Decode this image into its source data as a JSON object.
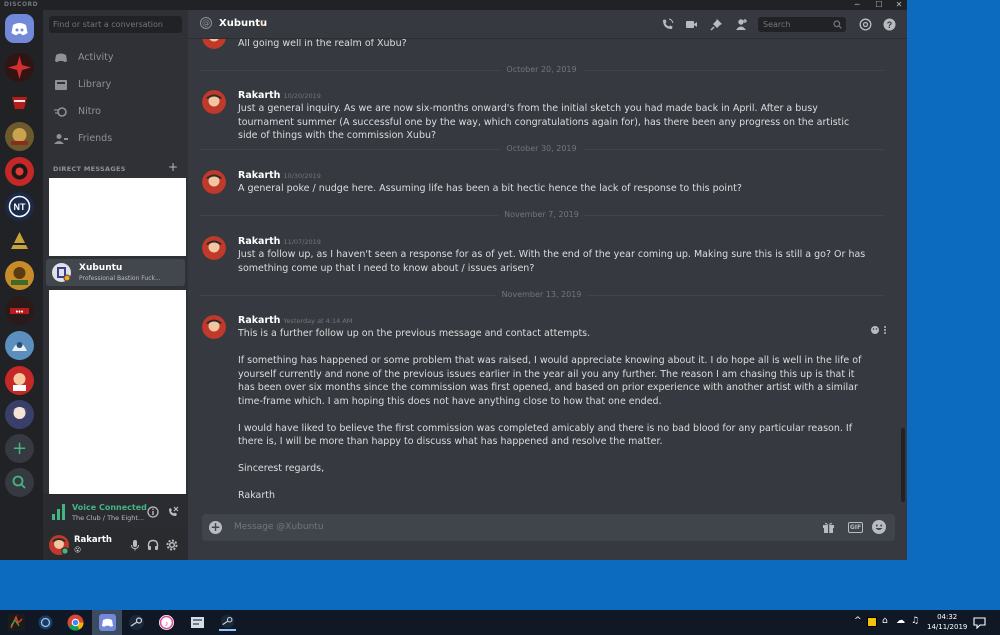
{
  "app": {
    "logo": "DISCORD"
  },
  "window_controls": [
    "minimize-icon",
    "maximize-icon",
    "close-icon"
  ],
  "sidebar": {
    "search_placeholder": "Find or start a conversation",
    "nav": [
      {
        "label": "Activity",
        "icon": "activity-icon"
      },
      {
        "label": "Library",
        "icon": "library-icon"
      },
      {
        "label": "Nitro",
        "icon": "nitro-icon"
      },
      {
        "label": "Friends",
        "icon": "friends-icon"
      }
    ],
    "dm_header": "DIRECT MESSAGES",
    "active_dm": {
      "name": "Xubuntu",
      "status": "Professional Bastion Fuck..."
    },
    "voice": {
      "title": "Voice Connected",
      "subtitle": "The Club / The Eight..."
    },
    "user": {
      "name": "Rakarth",
      "status_emoji": "😮"
    }
  },
  "channel": {
    "name": "Xubuntu",
    "status_icon": "crescent-moon-icon",
    "search_placeholder": "Search"
  },
  "composer": {
    "placeholder": "Message @Xubuntu",
    "gif_label": "GIF"
  },
  "messages": {
    "top_text": "All going well in the realm of Xubu?",
    "dividers": [
      "October 20, 2019",
      "October 30, 2019",
      "November 7, 2019",
      "November 13, 2019"
    ],
    "groups": [
      {
        "author": "Rakarth",
        "time": "10/20/2019",
        "paragraphs": [
          "Just a general inquiry. As we are now six-months onward's from the initial sketch you had made back in April. After a busy tournament summer (A successful one by the way, which congratulations again for), has there been any progress on the artistic side of things with the commission Xubu?"
        ]
      },
      {
        "author": "Rakarth",
        "time": "10/30/2019",
        "paragraphs": [
          "A general poke / nudge here. Assuming life has been a bit hectic hence the lack of response to this point?"
        ]
      },
      {
        "author": "Rakarth",
        "time": "11/07/2019",
        "paragraphs": [
          "Just a follow up, as I haven't seen a response for as of yet. With the end of the year coming up. Making sure this is still a go? Or has something come up that I need to know about / issues arisen?"
        ]
      },
      {
        "author": "Rakarth",
        "time": "Yesterday at 4:14 AM",
        "paragraphs": [
          "This is a further follow up on the previous message and contact attempts.",
          "If something has happened or some problem that was raised, I would appreciate knowing about it. I do hope all is well in the life of yourself currently and none of the previous issues earlier in the year ail you any further. The reason I am chasing this up is that it has been over six months since the commission was first opened, and based on prior experience with another artist with a similar time-frame which. I am hoping this does not have anything close to how that one ended.",
          "I would have liked to believe the first commission was completed amicably and there is no bad blood for any particular reason. If there is, I will be more than happy to discuss what has happened and resolve the matter.",
          "Sincerest regards,",
          "Rakarth"
        ]
      }
    ]
  },
  "taskbar": {
    "time": "04:32",
    "date": "14/11/2019"
  },
  "colors": {
    "accent": "#7289da",
    "online": "#43b581",
    "idle_moon": "#faa61a"
  }
}
